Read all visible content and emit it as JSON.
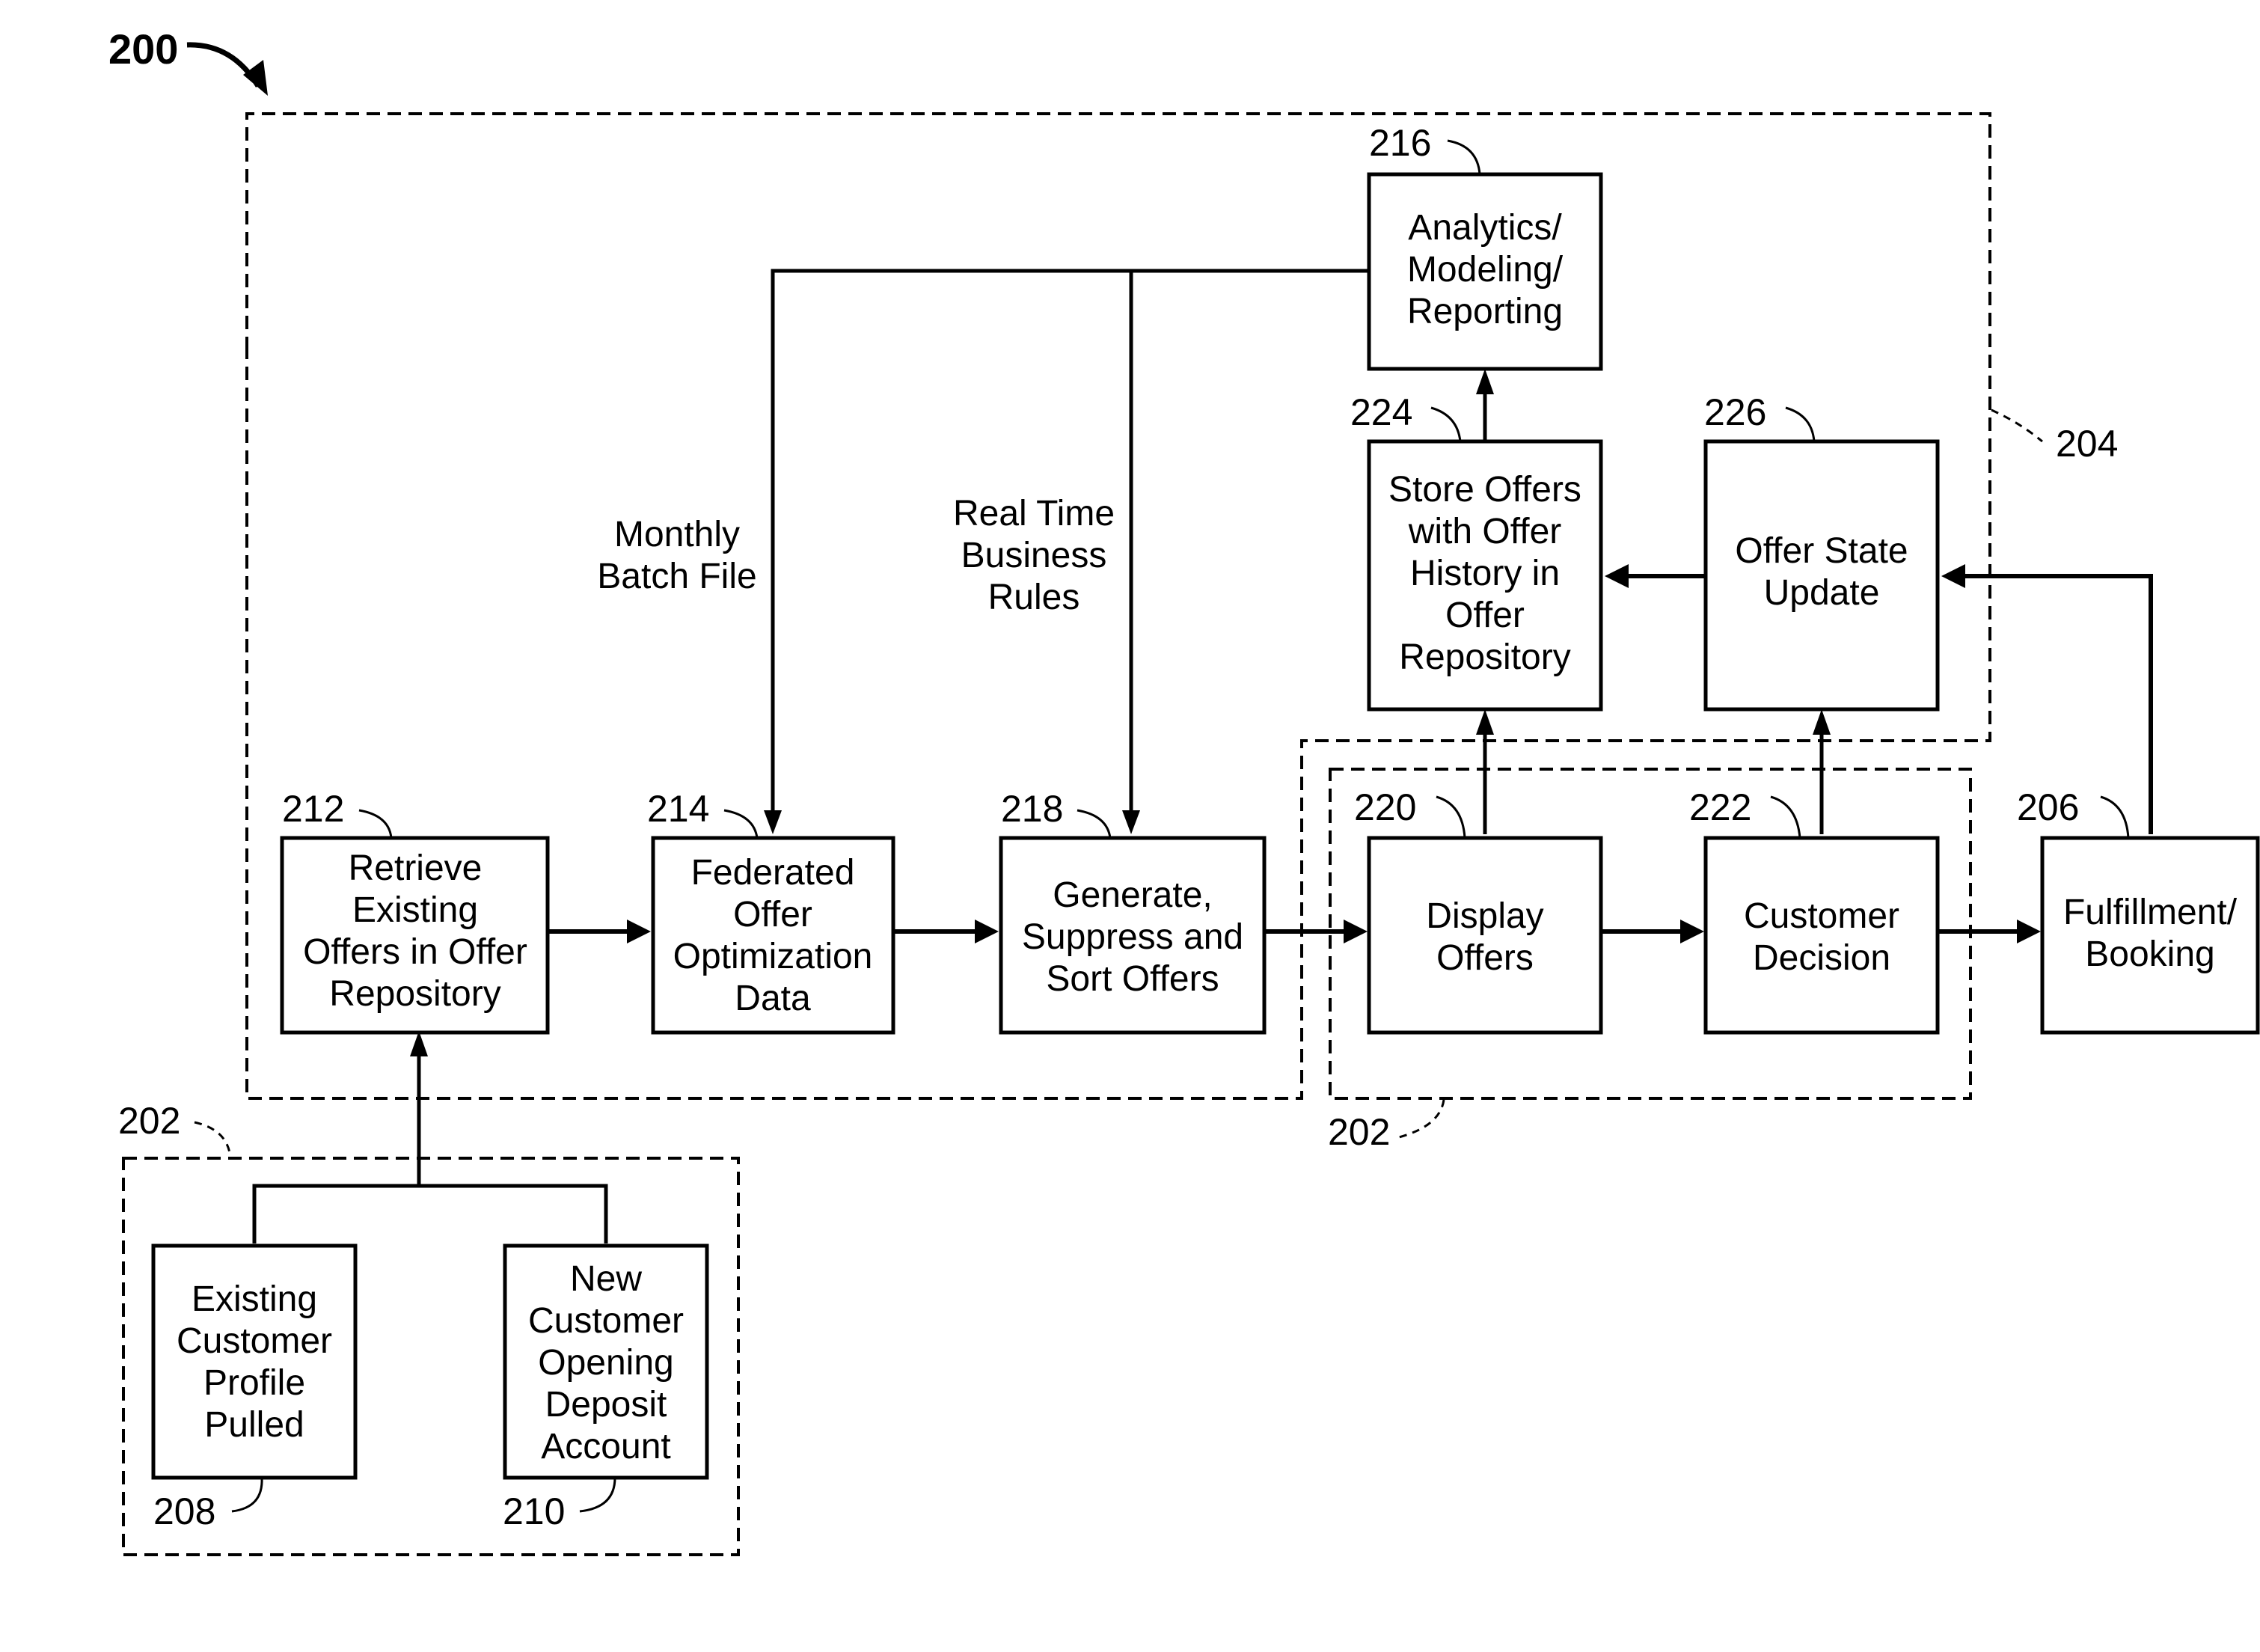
{
  "figure": {
    "number": "200"
  },
  "regions": {
    "r204": "204",
    "r202_top": "202",
    "r202_bottom": "202"
  },
  "nodes": {
    "n208": {
      "ref": "208",
      "lines": [
        "Existing",
        "Customer",
        "Profile",
        "Pulled"
      ]
    },
    "n210": {
      "ref": "210",
      "lines": [
        "New",
        "Customer",
        "Opening",
        "Deposit",
        "Account"
      ]
    },
    "n212": {
      "ref": "212",
      "lines": [
        "Retrieve",
        "Existing",
        "Offers in Offer",
        "Repository"
      ]
    },
    "n214": {
      "ref": "214",
      "lines": [
        "Federated",
        "Offer",
        "Optimization",
        "Data"
      ]
    },
    "n218": {
      "ref": "218",
      "lines": [
        "Generate,",
        "Suppress and",
        "Sort Offers"
      ]
    },
    "n220": {
      "ref": "220",
      "lines": [
        "Display",
        "Offers"
      ]
    },
    "n222": {
      "ref": "222",
      "lines": [
        "Customer",
        "Decision"
      ]
    },
    "n206": {
      "ref": "206",
      "lines": [
        "Fulfillment/",
        "Booking"
      ]
    },
    "n216": {
      "ref": "216",
      "lines": [
        "Analytics/",
        "Modeling/",
        "Reporting"
      ]
    },
    "n224": {
      "ref": "224",
      "lines": [
        "Store Offers",
        "with Offer",
        "History in",
        "Offer",
        "Repository"
      ]
    },
    "n226": {
      "ref": "226",
      "lines": [
        "Offer State",
        "Update"
      ]
    }
  },
  "edge_labels": {
    "monthly": [
      "Monthly",
      "Batch File"
    ],
    "realtime": [
      "Real Time",
      "Business",
      "Rules"
    ]
  }
}
